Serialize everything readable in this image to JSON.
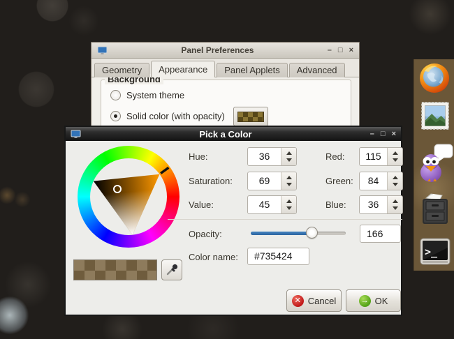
{
  "panel_preferences": {
    "title": "Panel Preferences",
    "window_controls": {
      "minimize": "–",
      "maximize": "□",
      "close": "×"
    },
    "tabs": [
      {
        "label": "Geometry",
        "selected": false
      },
      {
        "label": "Appearance",
        "selected": true
      },
      {
        "label": "Panel Applets",
        "selected": false
      },
      {
        "label": "Advanced",
        "selected": false
      }
    ],
    "background_group": {
      "label": "Background",
      "options": [
        {
          "label": "System theme",
          "selected": false
        },
        {
          "label": "Solid color (with opacity)",
          "selected": true
        }
      ]
    }
  },
  "color_dialog": {
    "title": "Pick a Color",
    "window_controls": {
      "minimize": "–",
      "maximize": "□",
      "close": "×"
    },
    "hsv_fields": [
      {
        "label": "Hue:",
        "value": "36"
      },
      {
        "label": "Saturation:",
        "value": "69"
      },
      {
        "label": "Value:",
        "value": "45"
      }
    ],
    "rgb_fields": [
      {
        "label": "Red:",
        "value": "115"
      },
      {
        "label": "Green:",
        "value": "84"
      },
      {
        "label": "Blue:",
        "value": "36"
      }
    ],
    "opacity": {
      "label": "Opacity:",
      "value": "166",
      "fill_percent": "65%"
    },
    "color_name": {
      "label": "Color name:",
      "value": "#735424"
    },
    "buttons": {
      "cancel": "Cancel",
      "ok": "OK"
    },
    "hue_degrees": 36,
    "swatch_color": "#735424",
    "accent_blue": "#3670ae"
  },
  "dock": {
    "terminal_glyph": ">_",
    "items": [
      {
        "name": "firefox"
      },
      {
        "name": "mail"
      },
      {
        "name": "pidgin"
      },
      {
        "name": "file-cabinet"
      },
      {
        "name": "terminal"
      }
    ]
  }
}
